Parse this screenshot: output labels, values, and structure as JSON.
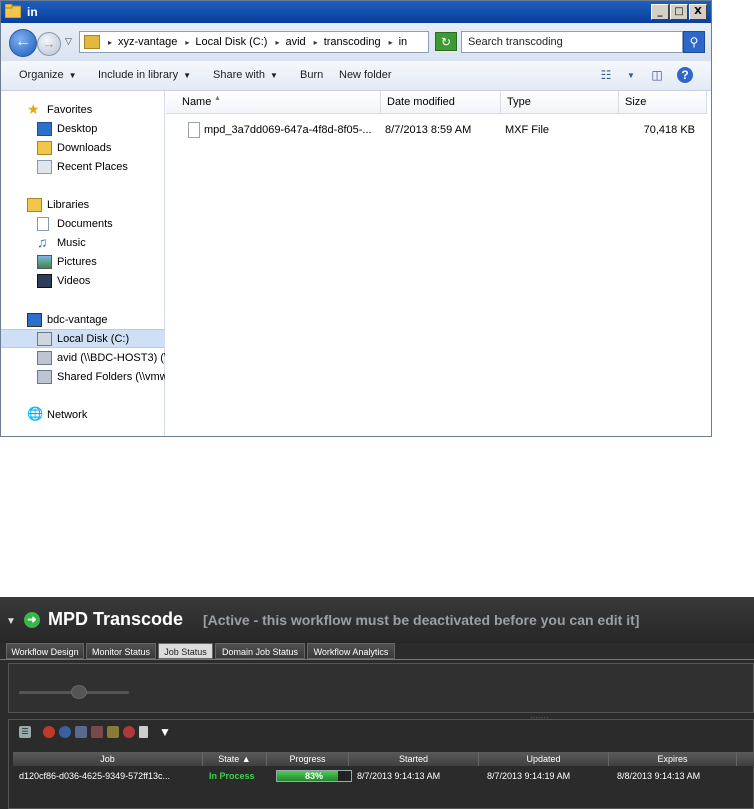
{
  "explorer": {
    "window_title": "in",
    "window_buttons": {
      "minimize": "_",
      "maximize": "□",
      "close": "X"
    },
    "breadcrumbs": [
      "xyz-vantage",
      "Local Disk (C:)",
      "avid",
      "transcoding",
      "in"
    ],
    "search_placeholder": "Search transcoding",
    "commands": {
      "organize": "Organize",
      "include_in_library": "Include in library",
      "share_with": "Share with",
      "burn": "Burn",
      "new_folder": "New folder"
    },
    "nav": {
      "favorites": "Favorites",
      "desktop": "Desktop",
      "downloads": "Downloads",
      "recent_places": "Recent Places",
      "libraries": "Libraries",
      "documents": "Documents",
      "music": "Music",
      "pictures": "Pictures",
      "videos": "Videos",
      "computer": "bdc-vantage",
      "local_disk": "Local Disk (C:)",
      "avid_share": "avid (\\\\BDC-HOST3) (\\",
      "shared_folders": "Shared Folders (\\\\vmw",
      "network": "Network"
    },
    "columns": {
      "name": "Name",
      "date_modified": "Date modified",
      "type": "Type",
      "size": "Size"
    },
    "files": [
      {
        "name": "mpd_3a7dd069-647a-4f8d-8f05-...",
        "date_modified": "8/7/2013 8:59 AM",
        "type": "MXF File",
        "size": "70,418 KB"
      }
    ]
  },
  "vantage": {
    "workflow_title": "MPD Transcode",
    "status_note": "[Active - this workflow must be deactivated before you can edit it]",
    "tabs": [
      "Workflow Design",
      "Monitor Status",
      "Job Status",
      "Domain Job Status",
      "Workflow Analytics"
    ],
    "active_tab": "Job Status",
    "columns": {
      "job": "Job",
      "state": "State ▲",
      "progress": "Progress",
      "started": "Started",
      "updated": "Updated",
      "expires": "Expires"
    },
    "jobs": [
      {
        "job": "d120cf86-d036-4625-9349-572ff13c...",
        "state": "In Process",
        "progress_label": "83%",
        "progress_fraction": 0.83,
        "started": "8/7/2013 9:14:13 AM",
        "updated": "8/7/2013 9:14:19 AM",
        "expires": "8/8/2013 9:14:13 AM"
      }
    ],
    "colors": {
      "state_in_process": "#39d24a",
      "progress_fill": "#2fa83a"
    }
  }
}
